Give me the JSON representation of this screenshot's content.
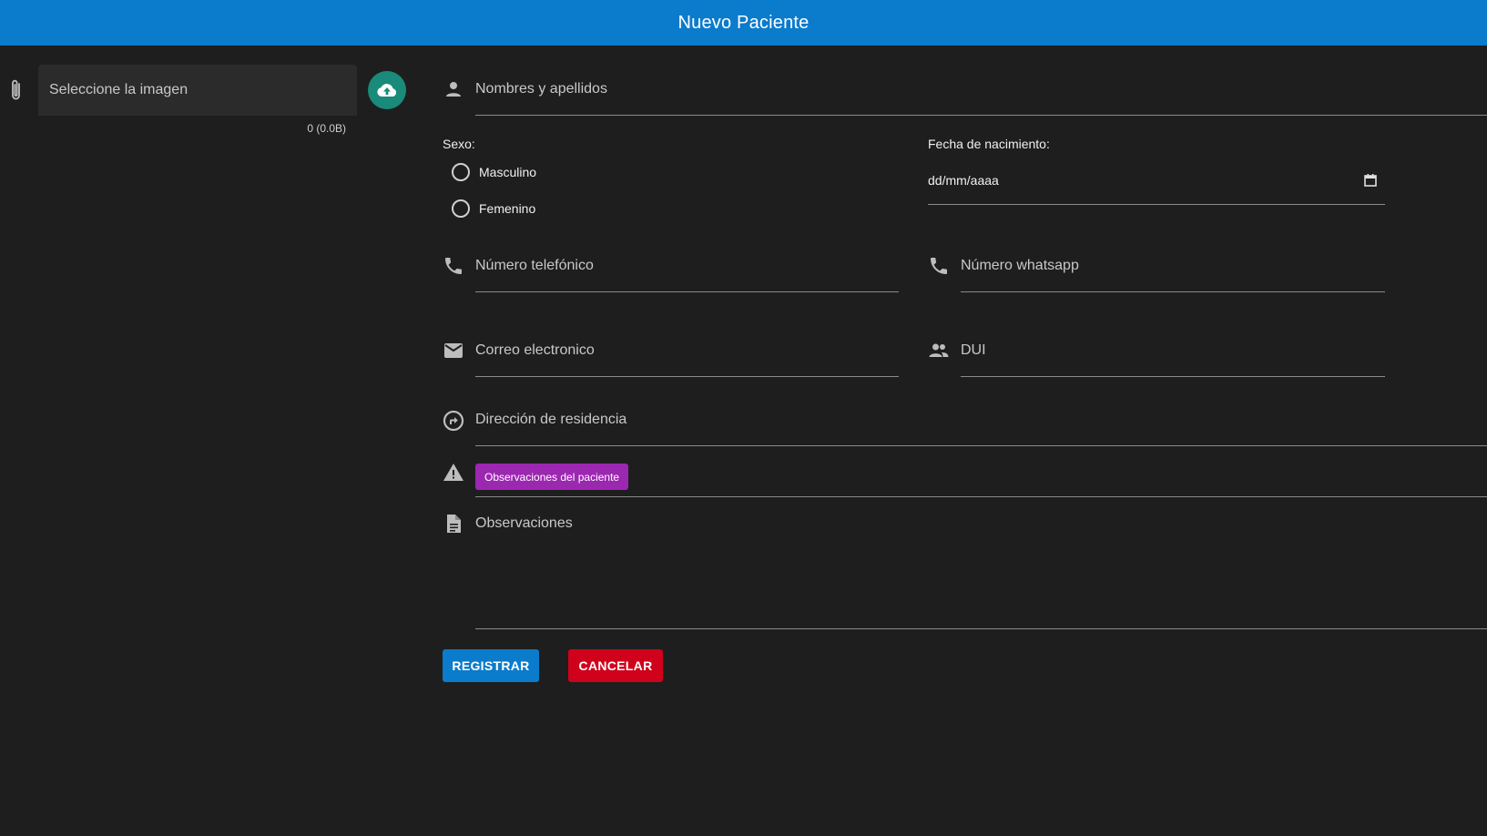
{
  "header": {
    "title": "Nuevo Paciente"
  },
  "file_picker": {
    "placeholder": "Seleccione la imagen",
    "counter": "0 (0.0B)",
    "icons": {
      "attach": "paperclip-icon",
      "upload": "cloud-upload-icon"
    },
    "upload_color": "#1a8a7a"
  },
  "form": {
    "full_name": {
      "label": "Nombres y apellidos",
      "icon": "person-icon"
    },
    "sex": {
      "label": "Sexo:",
      "options": [
        "Masculino",
        "Femenino"
      ]
    },
    "birth_date": {
      "label": "Fecha de nacimiento:",
      "value": "dd/mm/aaaa",
      "icon": "calendar-icon"
    },
    "phone": {
      "label": "Número telefónico",
      "icon": "phone-icon"
    },
    "whatsapp": {
      "label": "Número whatsapp",
      "icon": "phone-icon"
    },
    "email": {
      "label": "Correo electronico",
      "icon": "email-icon"
    },
    "dui": {
      "label": "DUI",
      "icon": "people-icon"
    },
    "address": {
      "label": "Dirección de residencia",
      "icon": "directions-icon"
    },
    "patient_notes": {
      "chip": "Observaciones del paciente",
      "icon": "warning-icon",
      "chip_color": "#9c27b0"
    },
    "observations": {
      "label": "Observaciones",
      "icon": "document-icon"
    }
  },
  "actions": {
    "register": "REGISTRAR",
    "cancel": "CANCELAR",
    "register_color": "#0b7bcc",
    "cancel_color": "#d0021b"
  },
  "colors": {
    "header": "#0b7bcc",
    "background": "#1e1e1e"
  }
}
